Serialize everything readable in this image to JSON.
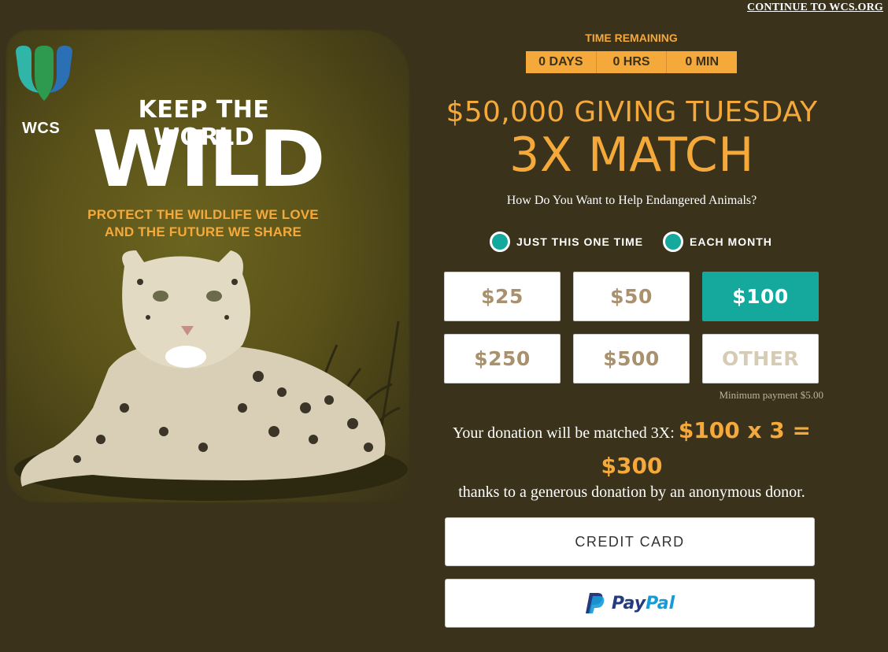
{
  "header": {
    "continue_link": "CONTINUE TO WCS.ORG"
  },
  "hero": {
    "logo_text": "WCS",
    "keep_line": "KEEP THE WORLD",
    "wild_line": "WILD",
    "protect_line1": "PROTECT THE WILDLIFE WE LOVE",
    "protect_line2": "AND THE FUTURE WE SHARE"
  },
  "timer": {
    "label": "TIME REMAINING",
    "days": "0 DAYS",
    "hours": "0 HRS",
    "minutes": "0 MIN"
  },
  "campaign": {
    "headline": "$50,000 GIVING TUESDAY",
    "match": "3X MATCH",
    "question": "How Do You Want to Help Endangered Animals?"
  },
  "frequency": {
    "one_time": "JUST THIS ONE TIME",
    "monthly": "EACH MONTH"
  },
  "amounts": [
    {
      "label": "$25",
      "selected": false
    },
    {
      "label": "$50",
      "selected": false
    },
    {
      "label": "$100",
      "selected": true
    },
    {
      "label": "$250",
      "selected": false
    },
    {
      "label": "$500",
      "selected": false
    },
    {
      "label": "OTHER",
      "selected": false
    }
  ],
  "minimum": "Minimum payment $5.00",
  "matched": {
    "prefix": "Your donation will be matched 3X:",
    "calc": "$100 x 3 =",
    "total": "$300",
    "thanks": "thanks to a generous donation by an anonymous donor."
  },
  "payment": {
    "credit_card": "CREDIT CARD",
    "paypal_pay": "Pay",
    "paypal_pal": "Pal"
  },
  "colors": {
    "background": "#3a321a",
    "accent_orange": "#f5a93b",
    "accent_teal": "#14a99c"
  }
}
